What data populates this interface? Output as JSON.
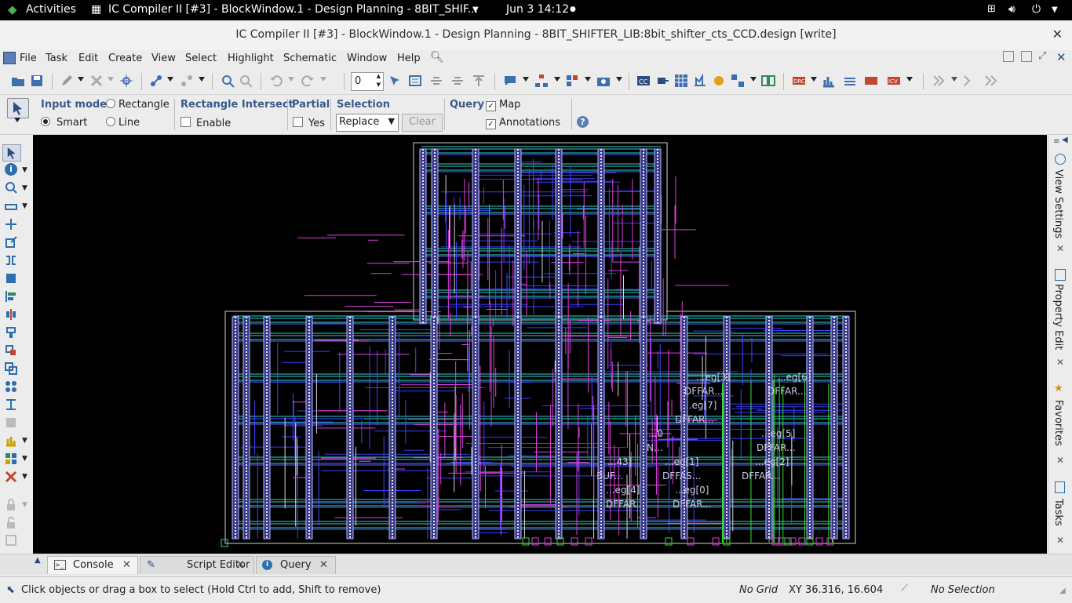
{
  "topbar": {
    "activities": "Activities",
    "app_title": "IC Compiler II [#3] - BlockWindow.1 - Design Planning - 8BIT_SHIF...",
    "clock": "Jun 3  14:12"
  },
  "window": {
    "title": "IC Compiler II [#3] - BlockWindow.1 - Design Planning - 8BIT_SHIFTER_LIB:8bit_shifter_cts_CCD.design [write]",
    "close": "✕"
  },
  "menu": {
    "file": "File",
    "task": "Task",
    "edit": "Edit",
    "create": "Create",
    "view": "View",
    "select": "Select",
    "highlight": "Highlight",
    "schematic": "Schematic",
    "window": "Window",
    "help": "Help"
  },
  "toolbar": {
    "spin_value": "0"
  },
  "options": {
    "input_mode_label": "Input mode",
    "rectangle": "Rectangle",
    "smart": "Smart",
    "line": "Line",
    "rect_intersect_label": "Rectangle Intersect",
    "enable": "Enable",
    "partial_label": "Partial",
    "yes": "Yes",
    "selection_label": "Selection",
    "selection_value": "Replace",
    "clear": "Clear",
    "query_label": "Query",
    "map": "Map",
    "annotations": "Annotations"
  },
  "right_dock": {
    "view_settings": "View Settings",
    "property_editor": "Property Edit",
    "favorites": "Favorites",
    "tasks": "Tasks"
  },
  "layout": {
    "cell_labels": [
      "...eg[3]",
      "...eg[6]",
      "DFFAR...",
      "DFFAR...",
      "...eg[7]",
      "DFFAR...",
      "...0",
      "...eg[5]",
      "N...",
      "DFFAR...",
      "...43]",
      "...eg[1]",
      "...eg[2]",
      "BUF...",
      "DFFAS...",
      "DFFAR...",
      "...eg[4]",
      "...eg[0]",
      "DFFAR...",
      "DFFAR..."
    ]
  },
  "bottom_tabs": {
    "console": "Console",
    "script_editor": "Script Editor",
    "query": "Query"
  },
  "status": {
    "hint": "Click objects or drag a box to select (Hold Ctrl to add, Shift to remove)",
    "grid": "No Grid",
    "coords": "XY 36.316, 16.604",
    "selection": "No Selection"
  }
}
